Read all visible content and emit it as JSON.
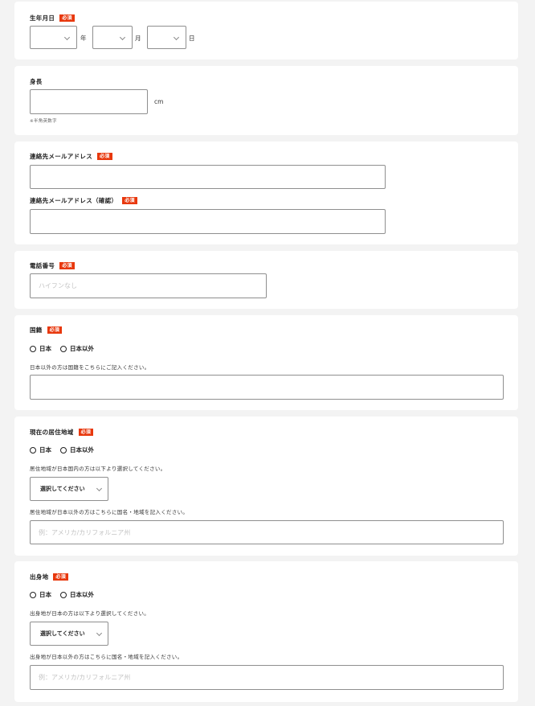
{
  "required_label": "必須",
  "birth": {
    "label": "生年月日",
    "year_unit": "年",
    "month_unit": "月",
    "day_unit": "日"
  },
  "height": {
    "label": "身長",
    "unit": "cm",
    "note": "※半角英数字"
  },
  "email": {
    "label": "連絡先メールアドレス",
    "confirm_label": "連絡先メールアドレス（確認）"
  },
  "phone": {
    "label": "電話番号",
    "placeholder": "ハイフンなし"
  },
  "nationality": {
    "label": "国籍",
    "options": [
      "日本",
      "日本以外"
    ],
    "note": "日本以外の方は国籍をこちらにご記入ください。"
  },
  "residence": {
    "label": "現在の居住地域",
    "options": [
      "日本",
      "日本以外"
    ],
    "select_note": "居住地域が日本国内の方は以下より選択してください。",
    "select_value": "選択してください",
    "text_note": "居住地域が日本以外の方はこちらに国名・地域を記入ください。",
    "placeholder": "例：アメリカ/カリフォルニア州"
  },
  "birthplace": {
    "label": "出身地",
    "options": [
      "日本",
      "日本以外"
    ],
    "select_note": "出身地が日本の方は以下より選択してください。",
    "select_value": "選択してください",
    "text_note": "出身地が日本以外の方はこちらに国名・地域を記入ください。",
    "placeholder": "例：アメリカ/カリフォルニア州"
  }
}
